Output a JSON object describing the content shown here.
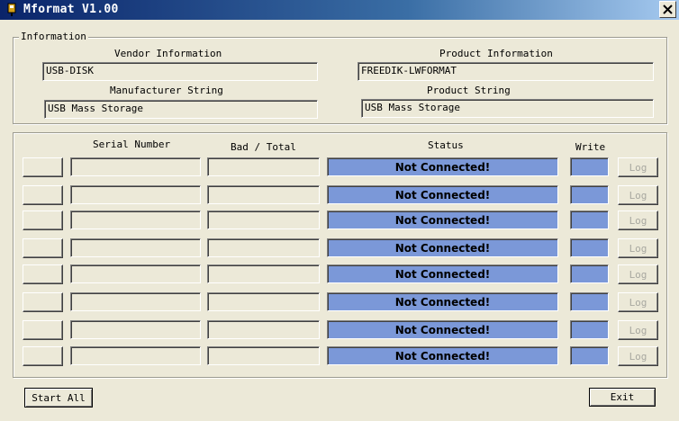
{
  "window": {
    "title": "Mformat V1.00"
  },
  "info": {
    "group_title": "Information",
    "vendor_label": "Vendor Information",
    "vendor_value": "USB-DISK",
    "product_label": "Product Information",
    "product_value": "FREEDIK-LWFORMAT",
    "manufacturer_label": "Manufacturer String",
    "manufacturer_value": "USB Mass Storage",
    "product_string_label": "Product String",
    "product_string_value": "USB Mass Storage"
  },
  "ports": {
    "headers": {
      "serial": "Serial Number",
      "bad_total": "Bad / Total",
      "status": "Status",
      "write": "Write"
    },
    "rows": [
      {
        "status": "Not Connected!",
        "log": "Log"
      },
      {
        "status": "Not Connected!",
        "log": "Log"
      },
      {
        "status": "Not Connected!",
        "log": "Log"
      },
      {
        "status": "Not Connected!",
        "log": "Log"
      },
      {
        "status": "Not Connected!",
        "log": "Log"
      },
      {
        "status": "Not Connected!",
        "log": "Log"
      },
      {
        "status": "Not Connected!",
        "log": "Log"
      },
      {
        "status": "Not Connected!",
        "log": "Log"
      }
    ]
  },
  "buttons": {
    "start_all": "Start All",
    "exit": "Exit"
  },
  "colors": {
    "status_fill": "#7b98d8",
    "titlebar": "#0a246a"
  }
}
